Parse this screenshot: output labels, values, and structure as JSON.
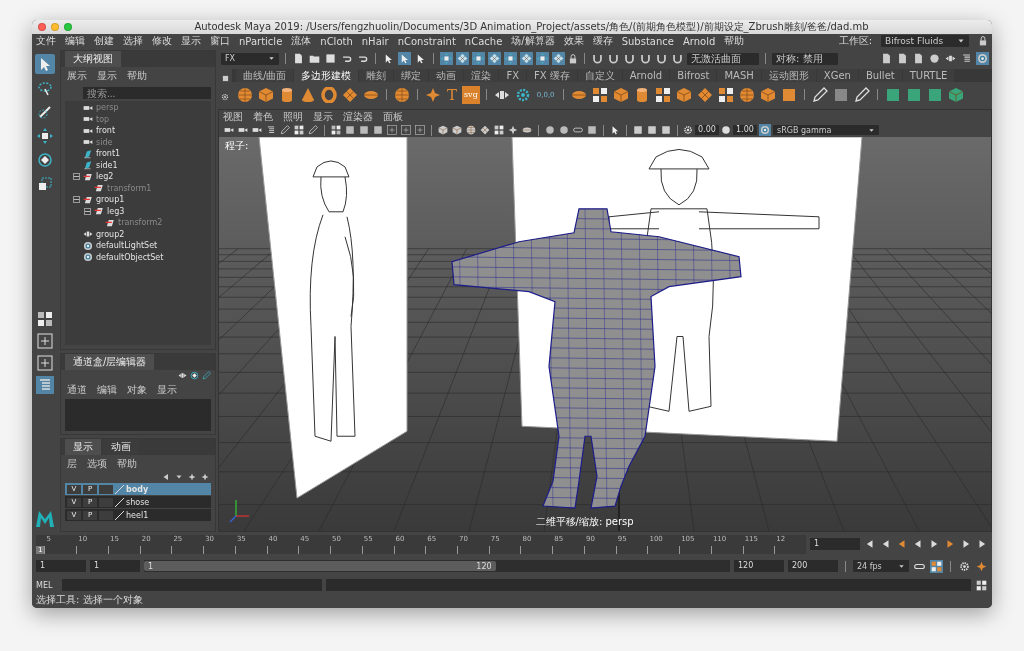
{
  "window": {
    "title": "Autodesk Maya 2019: /Users/fengzhuolin/Documents/3D Animation_Project/assets/角色/(前期角色模型)/前期设定_Zbrush雕刻/爸爸/dad.mb"
  },
  "menu_bar": [
    "文件",
    "编辑",
    "创建",
    "选择",
    "修改",
    "显示",
    "窗口",
    "nParticle",
    "流体",
    "nCloth",
    "nHair",
    "nConstraint",
    "nCache",
    "场/解算器",
    "效果",
    "缓存",
    "Substance",
    "Arnold",
    "帮助"
  ],
  "workspace": {
    "label": "工作区:",
    "value": "Bifrost Fluids"
  },
  "status_line": {
    "menu_set": "FX",
    "live_surface": "无激活曲面",
    "symmetry": "对称: 禁用",
    "mode_buttons": [
      {
        "selected": false
      },
      {
        "selected": true
      },
      {
        "selected": false
      }
    ],
    "mask_buttons": [
      {
        "on": true
      },
      {
        "on": true
      },
      {
        "on": true
      },
      {
        "on": true
      },
      {
        "on": true
      },
      {
        "on": true
      },
      {
        "on": true
      },
      {
        "on": true
      }
    ]
  },
  "toolbox": [
    {
      "kind": "select",
      "selected": true
    },
    {
      "kind": "lasso",
      "selected": false
    },
    {
      "kind": "paint",
      "selected": false
    },
    {
      "kind": "move",
      "selected": false
    },
    {
      "kind": "rotate",
      "selected": false
    },
    {
      "kind": "scale",
      "selected": false
    }
  ],
  "shelf": {
    "tabs": [
      {
        "label": "曲线/曲面",
        "selected": false
      },
      {
        "label": "多边形建模",
        "selected": true
      },
      {
        "label": "雕刻",
        "selected": false
      },
      {
        "label": "绑定",
        "selected": false
      },
      {
        "label": "动画",
        "selected": false
      },
      {
        "label": "渲染",
        "selected": false
      },
      {
        "label": "FX",
        "selected": false
      },
      {
        "label": "FX 缓存",
        "selected": false
      },
      {
        "label": "自定义",
        "selected": false
      },
      {
        "label": "Arnold",
        "selected": false
      },
      {
        "label": "Bifrost",
        "selected": false
      },
      {
        "label": "MASH",
        "selected": false
      },
      {
        "label": "运动图形",
        "selected": false
      },
      {
        "label": "XGen",
        "selected": false
      },
      {
        "label": "Bullet",
        "selected": false
      },
      {
        "label": "TURTLE",
        "selected": false
      }
    ],
    "text_buttons": [
      "T",
      "svg",
      "0,0,0"
    ]
  },
  "outliner": {
    "title": "大纲视图",
    "menu": [
      "展示",
      "显示",
      "帮助"
    ],
    "search": {
      "placeholder": "搜索..."
    },
    "items": [
      {
        "label": "persp",
        "kind": "camera",
        "dimmed": true
      },
      {
        "label": "top",
        "kind": "camera",
        "dimmed": true
      },
      {
        "label": "front",
        "kind": "camera",
        "dimmed": false
      },
      {
        "label": "side",
        "kind": "camera",
        "dimmed": true
      },
      {
        "label": "front1",
        "kind": "image_plane",
        "dimmed": false
      },
      {
        "label": "side1",
        "kind": "image_plane",
        "dimmed": false
      },
      {
        "label": "leg2",
        "kind": "transform",
        "dimmed": false,
        "expanded": true,
        "children": [
          {
            "label": "transform1",
            "kind": "transform",
            "dimmed": true
          }
        ]
      },
      {
        "label": "group1",
        "kind": "transform",
        "dimmed": false,
        "expanded": true,
        "children": [
          {
            "label": "leg3",
            "kind": "transform",
            "dimmed": false,
            "expanded": true,
            "children": [
              {
                "label": "transform2",
                "kind": "transform",
                "dimmed": true
              }
            ]
          }
        ]
      },
      {
        "label": "group2",
        "kind": "group",
        "dimmed": false
      },
      {
        "label": "defaultLightSet",
        "kind": "set",
        "dimmed": false
      },
      {
        "label": "defaultObjectSet",
        "kind": "set",
        "dimmed": false
      }
    ]
  },
  "channel_box": {
    "title": "通道盒/层编辑器",
    "menu": [
      "通道",
      "编辑",
      "对象",
      "显示"
    ]
  },
  "layer_editor": {
    "tabs": [
      {
        "label": "显示",
        "selected": true
      },
      {
        "label": "动画",
        "selected": false
      }
    ],
    "menu": [
      "层",
      "选项",
      "帮助"
    ],
    "layers": [
      {
        "visible": "V",
        "playback": "P",
        "name": "body",
        "selected": true
      },
      {
        "visible": "V",
        "playback": "P",
        "name": "shose",
        "selected": false
      },
      {
        "visible": "V",
        "playback": "P",
        "name": "heel1",
        "selected": false
      }
    ]
  },
  "viewport": {
    "menu": [
      "视图",
      "着色",
      "照明",
      "显示",
      "渲染器",
      "面板"
    ],
    "exposure": "0.00",
    "gamma": "1.00",
    "color_space": "sRGB gamma",
    "camera_label": "程子:",
    "hud": "二维平移/缩放: persp"
  },
  "timeline": {
    "current_frame_mark": "1",
    "ticks": [
      "5",
      "10",
      "15",
      "20",
      "25",
      "30",
      "35",
      "40",
      "45",
      "50",
      "55",
      "60",
      "65",
      "70",
      "75",
      "80",
      "85",
      "90",
      "95",
      "100",
      "105",
      "110",
      "115",
      "12"
    ],
    "current_frame": "1"
  },
  "range": {
    "start": "1",
    "playback_start": "1",
    "slider_start": "1",
    "slider_end": "120",
    "playback_end": "120",
    "end": "200",
    "fps": "24 fps",
    "level": 0.6
  },
  "command_line": {
    "label": "MEL"
  },
  "help_line": "选择工具: 选择一个对象"
}
